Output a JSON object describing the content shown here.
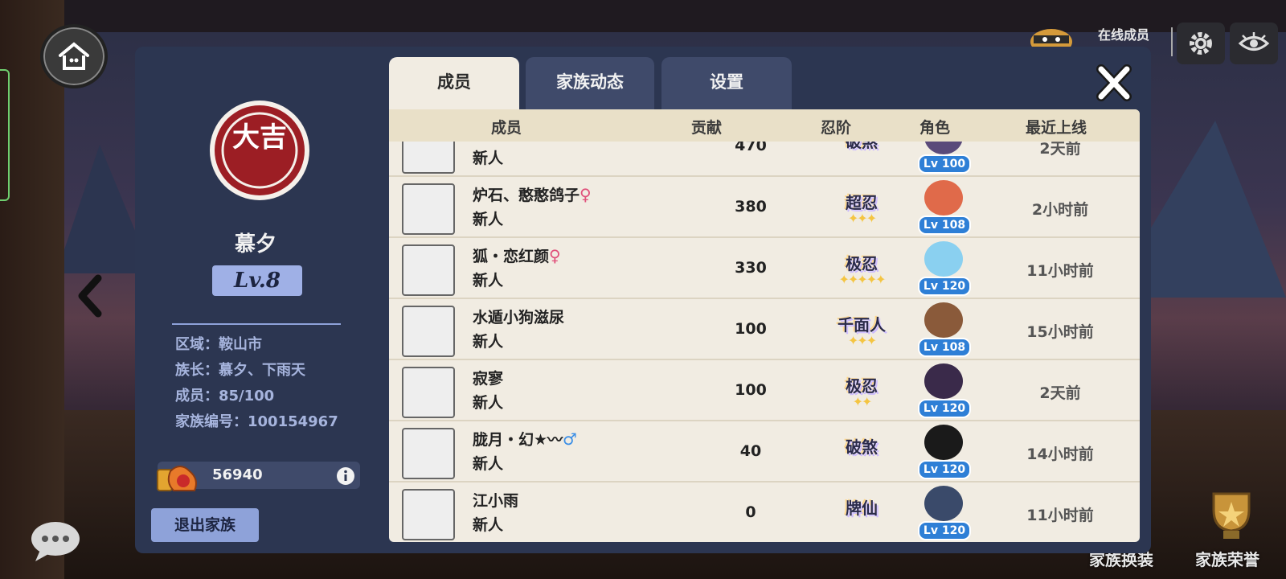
{
  "dialog": {
    "emblem_text": "大吉",
    "family_name": "慕夕",
    "level": "Lv.8",
    "info": {
      "region": "区域：鞍山市",
      "leader": "族长：慕夕、下雨天",
      "members": "成员：85/100",
      "family_id": "家族编号：100154967"
    },
    "funds": "56940",
    "exit_label": "退出家族",
    "tabs": [
      "成员",
      "家族动态",
      "设置"
    ],
    "table": {
      "headers": {
        "member": "成员",
        "contribution": "贡献",
        "rank": "忍阶",
        "character": "角色",
        "last_online": "最近上线"
      },
      "rows": [
        {
          "name": "",
          "gender": "",
          "role": "新人",
          "contribution": "470",
          "rank": "破煞",
          "stars": "",
          "level": "Lv 100",
          "last_online": "2天前"
        },
        {
          "name": "炉石、憨憨鸽子",
          "gender": "♀",
          "role": "新人",
          "contribution": "380",
          "rank": "超忍",
          "stars": "✦✦✦",
          "level": "Lv 108",
          "last_online": "2小时前"
        },
        {
          "name": "狐・恋红颜",
          "gender": "♀",
          "role": "新人",
          "contribution": "330",
          "rank": "极忍",
          "stars": "✦✦✦✦✦",
          "level": "Lv 120",
          "last_online": "11小时前"
        },
        {
          "name": "水遁小狗滋尿",
          "gender": "",
          "role": "新人",
          "contribution": "100",
          "rank": "千面人",
          "stars": "✦✦✦",
          "level": "Lv 108",
          "last_online": "15小时前"
        },
        {
          "name": "寂寥",
          "gender": "",
          "role": "新人",
          "contribution": "100",
          "rank": "极忍",
          "stars": "✦✦",
          "level": "Lv 120",
          "last_online": "2天前"
        },
        {
          "name": "胧月・幻★〰",
          "gender": "♂",
          "role": "新人",
          "contribution": "40",
          "rank": "破煞",
          "stars": "",
          "level": "Lv 120",
          "last_online": "14小时前"
        },
        {
          "name": "江小雨",
          "gender": "",
          "role": "新人",
          "contribution": "0",
          "rank": "牌仙",
          "stars": "",
          "level": "Lv 120",
          "last_online": "11小时前"
        }
      ]
    }
  },
  "top_right": {
    "online_label": "在线成员"
  },
  "bottom_right": {
    "outfit_label": "家族换装",
    "honor_label": "家族荣誉"
  },
  "colors": {
    "dialog_bg": "#2c3651",
    "table_bg": "#f1ece2",
    "accent_blue": "#8ea2d9",
    "lv_badge": "#2e7fd6",
    "female": "#e0507a",
    "male": "#3a8ee6"
  }
}
